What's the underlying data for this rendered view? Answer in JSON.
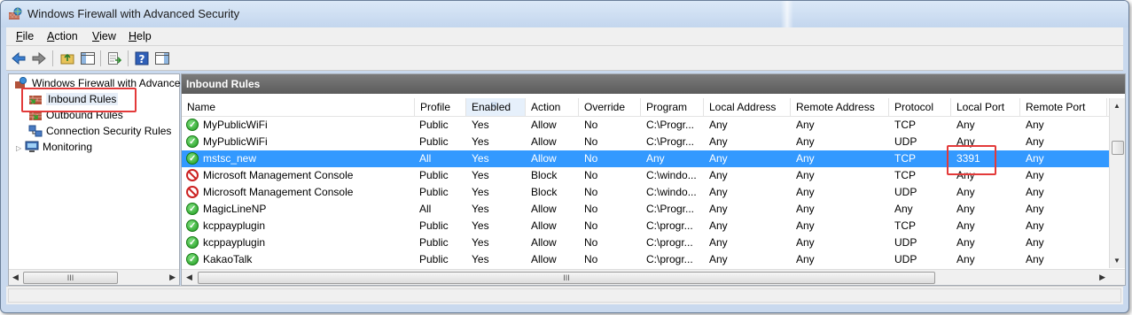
{
  "window": {
    "title": "Windows Firewall with Advanced Security"
  },
  "menu": [
    {
      "label": "File",
      "key": "F",
      "rest": "ile"
    },
    {
      "label": "Action",
      "key": "A",
      "rest": "ction"
    },
    {
      "label": "View",
      "key": "V",
      "rest": "iew"
    },
    {
      "label": "Help",
      "key": "H",
      "rest": "elp"
    }
  ],
  "toolbar": [
    "back-icon",
    "forward-icon",
    "up-folder-icon",
    "show-hide-console-tree-icon",
    "export-list-icon",
    "help-icon",
    "show-hide-action-pane-icon"
  ],
  "tree": {
    "root": "Windows Firewall with Advanced Security",
    "items": [
      "Inbound Rules",
      "Outbound Rules",
      "Connection Security Rules",
      "Monitoring"
    ]
  },
  "pane": {
    "title": "Inbound Rules"
  },
  "columns": [
    "Name",
    "Profile",
    "Enabled",
    "Action",
    "Override",
    "Program",
    "Local Address",
    "Remote Address",
    "Protocol",
    "Local Port",
    "Remote Port"
  ],
  "rows": [
    {
      "status": "allow",
      "name": "MyPublicWiFi",
      "profile": "Public",
      "enabled": "Yes",
      "action": "Allow",
      "override": "No",
      "program": "C:\\Progr...",
      "local_address": "Any",
      "remote_address": "Any",
      "protocol": "TCP",
      "local_port": "Any",
      "remote_port": "Any"
    },
    {
      "status": "allow",
      "name": "MyPublicWiFi",
      "profile": "Public",
      "enabled": "Yes",
      "action": "Allow",
      "override": "No",
      "program": "C:\\Progr...",
      "local_address": "Any",
      "remote_address": "Any",
      "protocol": "UDP",
      "local_port": "Any",
      "remote_port": "Any"
    },
    {
      "status": "allow",
      "name": "mstsc_new",
      "profile": "All",
      "enabled": "Yes",
      "action": "Allow",
      "override": "No",
      "program": "Any",
      "local_address": "Any",
      "remote_address": "Any",
      "protocol": "TCP",
      "local_port": "3391",
      "remote_port": "Any",
      "selected": true
    },
    {
      "status": "block",
      "name": "Microsoft Management Console",
      "profile": "Public",
      "enabled": "Yes",
      "action": "Block",
      "override": "No",
      "program": "C:\\windo...",
      "local_address": "Any",
      "remote_address": "Any",
      "protocol": "TCP",
      "local_port": "Any",
      "remote_port": "Any"
    },
    {
      "status": "block",
      "name": "Microsoft Management Console",
      "profile": "Public",
      "enabled": "Yes",
      "action": "Block",
      "override": "No",
      "program": "C:\\windo...",
      "local_address": "Any",
      "remote_address": "Any",
      "protocol": "UDP",
      "local_port": "Any",
      "remote_port": "Any"
    },
    {
      "status": "allow",
      "name": "MagicLineNP",
      "profile": "All",
      "enabled": "Yes",
      "action": "Allow",
      "override": "No",
      "program": "C:\\Progr...",
      "local_address": "Any",
      "remote_address": "Any",
      "protocol": "Any",
      "local_port": "Any",
      "remote_port": "Any"
    },
    {
      "status": "allow",
      "name": "kcppayplugin",
      "profile": "Public",
      "enabled": "Yes",
      "action": "Allow",
      "override": "No",
      "program": "C:\\progr...",
      "local_address": "Any",
      "remote_address": "Any",
      "protocol": "TCP",
      "local_port": "Any",
      "remote_port": "Any"
    },
    {
      "status": "allow",
      "name": "kcppayplugin",
      "profile": "Public",
      "enabled": "Yes",
      "action": "Allow",
      "override": "No",
      "program": "C:\\progr...",
      "local_address": "Any",
      "remote_address": "Any",
      "protocol": "UDP",
      "local_port": "Any",
      "remote_port": "Any"
    },
    {
      "status": "allow",
      "name": "KakaoTalk",
      "profile": "Public",
      "enabled": "Yes",
      "action": "Allow",
      "override": "No",
      "program": "C:\\progr...",
      "local_address": "Any",
      "remote_address": "Any",
      "protocol": "UDP",
      "local_port": "Any",
      "remote_port": "Any"
    }
  ],
  "scroll_grip": "III",
  "colors": {
    "selection": "#3399ff",
    "highlight_box": "#e33a3a",
    "pane_header": "#6a6a6a"
  }
}
